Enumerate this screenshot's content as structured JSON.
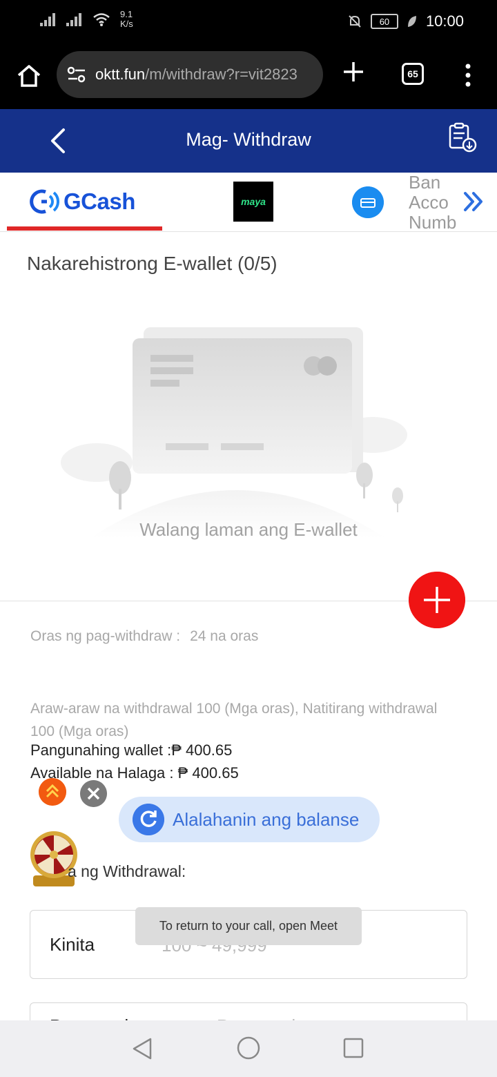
{
  "status_bar": {
    "net_speed_value": "9.1",
    "net_speed_unit": "K/s",
    "battery": "60",
    "time": "10:00"
  },
  "browser": {
    "url_host": "oktt.fun",
    "url_path": "/m/withdraw?r=vit2823",
    "tab_count": "65"
  },
  "header": {
    "title": "Mag- Withdraw"
  },
  "tabs": {
    "gcash_label": "GCash",
    "maya_label": "maya",
    "bank_label_lines": [
      "Ban",
      "Acco",
      "Numb"
    ]
  },
  "ewallet": {
    "section_title": "Nakarehistrong E-wallet (0/5)",
    "empty_text": "Walang laman ang E-wallet"
  },
  "info": {
    "withdraw_time_label": "Oras ng pag-withdraw :",
    "withdraw_time_value": "24 na oras",
    "daily_info": "Araw-araw na withdrawal 100 (Mga oras), Natitirang withdrawal 100 (Mga oras)",
    "main_wallet": "Pangunahing wallet :₱ 400.65",
    "available": "Available na Halaga : ₱ 400.65"
  },
  "balance_button": {
    "label": "Alalahanin ang balanse"
  },
  "amount": {
    "section_label": "a ng Withdrawal:",
    "field_label": "Kinita",
    "placeholder": "100 ~ 49,999"
  },
  "toast": {
    "text": "To return to your call, open Meet"
  },
  "password": {
    "label": "Password",
    "placeholder": "Password"
  },
  "colors": {
    "header_bg": "#15318a",
    "tab_active_underline": "#e02828",
    "fab": "#f01414",
    "gcash_blue": "#1752d8",
    "maya_green": "#2fe58a"
  }
}
